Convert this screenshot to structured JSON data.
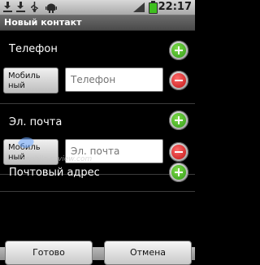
{
  "status_bar": {
    "time": "22:17",
    "icons": [
      "download-icon",
      "download-icon",
      "usb-icon",
      "android-icon",
      "signal-icon",
      "battery-icon"
    ],
    "battery_color": "#3fbf1f"
  },
  "title": "Новый контакт",
  "sections": {
    "phone": {
      "label": "Телефон",
      "type_label": "Мобиль ный",
      "placeholder": "Телефон"
    },
    "email": {
      "label": "Эл. почта",
      "type_label": "Мобиль ный",
      "placeholder": "Эл. почта"
    },
    "address": {
      "label": "Почтовый адрес"
    }
  },
  "watermark": "mobile-review.com",
  "buttons": {
    "done": "Готово",
    "cancel": "Отмена"
  },
  "colors": {
    "add_green": "#3fae1f",
    "remove_red": "#d01818"
  }
}
